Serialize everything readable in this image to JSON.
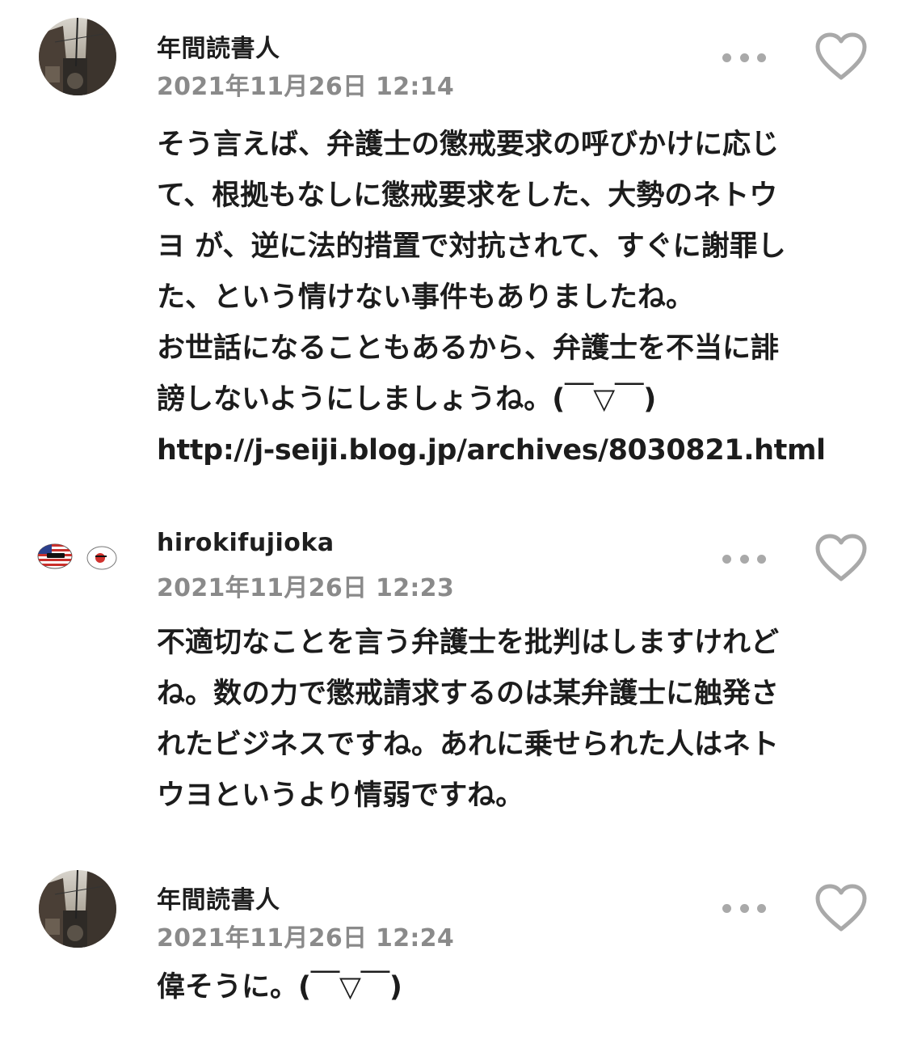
{
  "comments": [
    {
      "author": "年間読書人",
      "timestamp": "2021年11月26日 12:14",
      "body_lines": [
        "そう言えば、弁護士の懲戒要求の呼びかけに応じ",
        "て、根拠もなしに懲戒要求をした、大勢のネトウ",
        "ヨ が、逆に法的措置で対抗されて、すぐに謝罪し",
        "た、という情けない事件もありましたね。",
        "お世話になることもあるから、弁護士を不当に誹",
        "謗しないようにしましょうね。(￣▽￣)"
      ],
      "link": "http://j-seiji.blog.jp/archives/8030821.html"
    },
    {
      "author": "hirokifujioka",
      "timestamp": "2021年11月26日 12:23",
      "body_lines": [
        "不適切なことを言う弁護士を批判はしますけれど",
        "ね。数の力で懲戒請求するのは某弁護士に触発さ",
        "れたビジネスですね。あれに乗せられた人はネト",
        "ウヨというより情弱ですね。"
      ]
    },
    {
      "author": "年間読書人",
      "timestamp": "2021年11月26日 12:24",
      "body_lines": [
        "偉そうに。(￣▽￣)"
      ]
    }
  ],
  "icons": {
    "more": "more-horizontal-icon",
    "like": "heart-outline-icon"
  },
  "colors": {
    "text": "#1c1c1c",
    "timestamp": "#8a8a8a",
    "icon": "#a9a9a9"
  }
}
